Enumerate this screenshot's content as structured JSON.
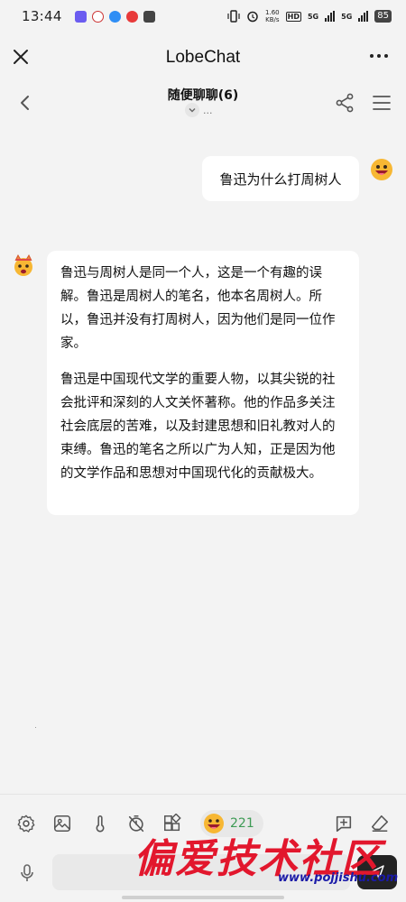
{
  "status_bar": {
    "time": "13:44",
    "net_speed_value": "1.60",
    "net_speed_unit": "KB/s",
    "hd_label": "HD",
    "net1": "5G",
    "net2": "5G",
    "battery": "85"
  },
  "app": {
    "title": "LobeChat"
  },
  "chat": {
    "title": "随便聊聊(6)",
    "subtitle": "..."
  },
  "messages": [
    {
      "role": "user",
      "text": "鲁迅为什么打周树人"
    },
    {
      "role": "assistant",
      "paragraphs": [
        "鲁迅与周树人是同一个人，这是一个有趣的误解。鲁迅是周树人的笔名，他本名周树人。所以，鲁迅并没有打周树人，因为他们是同一位作家。",
        "鲁迅是中国现代文学的重要人物，以其尖锐的社会批评和深刻的人文关怀著称。他的作品多关注社会底层的苦难，以及封建思想和旧礼教对人的束缚。鲁迅的笔名之所以广为人知，正是因为他的文学作品和思想对中国现代化的贡献极大。"
      ]
    }
  ],
  "toolbar": {
    "token_count": "221"
  },
  "icons": {
    "close": "close-icon",
    "more": "more-icon",
    "back": "chevron-left-icon",
    "share": "share-icon",
    "menu": "menu-icon",
    "settings": "gear-icon",
    "image": "image-icon",
    "temperature": "thermometer-icon",
    "timer": "timer-off-icon",
    "plugins": "plugin-icon",
    "add_topic": "add-topic-icon",
    "clear": "eraser-icon",
    "mic": "mic-icon",
    "send": "send-icon"
  },
  "watermark": {
    "text": "偏爱技术社区",
    "url": "www.pojjishu.com"
  }
}
